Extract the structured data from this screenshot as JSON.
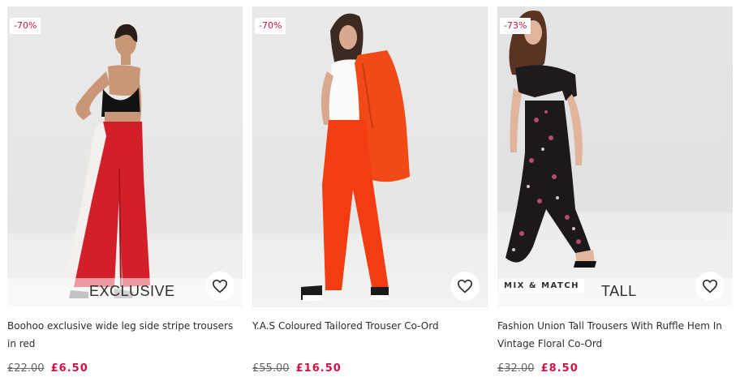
{
  "products": [
    {
      "discount": "-70%",
      "exclusive_label": "EXCLUSIVE",
      "title": "Boohoo exclusive wide leg side stripe trousers in red",
      "was_price": "£22.00",
      "now_price": "£6.50",
      "save_icon": "heart-icon"
    },
    {
      "discount": "-70%",
      "title": "Y.A.S Coloured Tailored Trouser Co-Ord",
      "was_price": "£55.00",
      "now_price": "£16.50",
      "save_icon": "heart-icon"
    },
    {
      "discount": "-73%",
      "badge": "MIX & MATCH",
      "tall_label": "TALL",
      "title": "Fashion Union Tall Trousers With Ruffle Hem In Vintage Floral Co-Ord",
      "was_price": "£32.00",
      "now_price": "£8.50",
      "save_icon": "heart-icon"
    }
  ],
  "colors": {
    "sale_red": "#d01345",
    "text": "#2d2d2d"
  }
}
